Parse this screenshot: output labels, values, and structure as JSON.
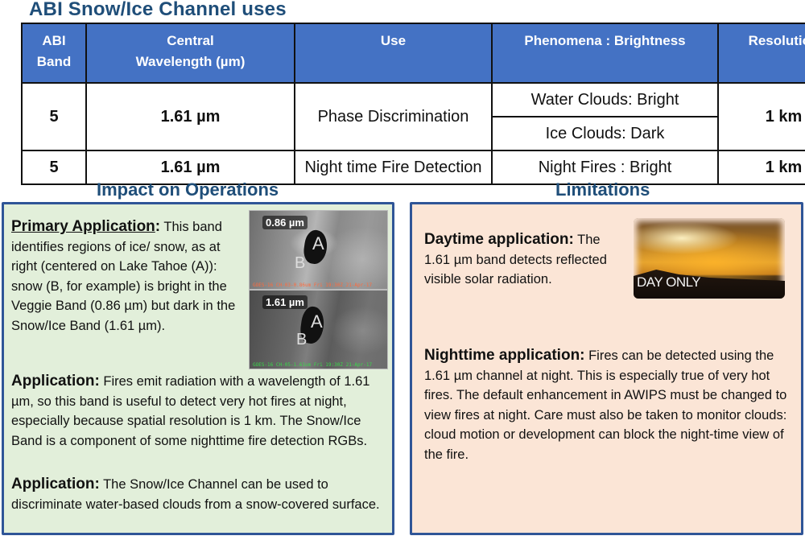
{
  "title": "ABI Snow/Ice Channel uses",
  "table": {
    "headers": [
      "ABI Band",
      "Central Wavelength (µm)",
      "Use",
      "Phenomena : Brightness",
      "Resolution"
    ],
    "header_lines": {
      "band_l1": "ABI",
      "band_l2": "Band",
      "wl_l1": "Central",
      "wl_l2": "Wavelength (µm)"
    },
    "rows": [
      {
        "band": "5",
        "wavelength": "1.61 µm",
        "use": "Phase Discrimination",
        "phenomena": [
          "Water Clouds: Bright",
          "Ice Clouds:  Dark"
        ],
        "resolution": "1 km"
      },
      {
        "band": "5",
        "wavelength": "1.61 µm",
        "use": "Night time Fire Detection",
        "phenomena": [
          "Night Fires : Bright"
        ],
        "resolution": "1 km"
      }
    ]
  },
  "impact": {
    "heading": "Impact on Operations",
    "primary_label": "Primary Application",
    "primary_colon": ":",
    "primary_text": " This band identifies regions of ice/ snow, as at right (centered on Lake Tahoe (A)): snow (B, for example) is bright in the Veggie Band (0.86 µm) but dark in the Snow/Ice Band (1.61 µm).",
    "app1_label": "Application:",
    "app1_text": " Fires emit radiation with a wavelength of 1.61 µm, so this band is useful to detect very hot fires at night, especially because spatial resolution is 1 km.  The Snow/Ice Band is a component of some nighttime fire detection RGBs.",
    "app2_label": "Application:",
    "app2_text": " The Snow/Ice Channel can be used to discriminate water-based clouds from a snow-covered surface.",
    "images": [
      {
        "label": "0.86 µm",
        "a": "A",
        "b": "B",
        "footer": "GOES-16 CH-03-0.86um   Fri 19:30Z 21-Apr-17"
      },
      {
        "label": "1.61 µm",
        "a": "A",
        "b": "B",
        "footer": "GOES-16 CH-05-1.61um   Fri 19:30Z 21-Apr-17"
      }
    ]
  },
  "limitations": {
    "heading": "Limitations",
    "day_label": "Daytime application:",
    "day_text": " The 1.61 µm  band detects reflected visible solar radiation.",
    "day_image_text": "DAY ONLY",
    "night_label": "Nighttime application:",
    "night_text": "  Fires can be detected using the 1.61 µm channel at night.  This is especially true of very hot fires.  The default enhancement in AWIPS must be changed to view fires at night.  Care must also be taken to monitor clouds:  cloud motion or development can block the night-time view of the fire."
  },
  "colors": {
    "header_blue": "#4472c4",
    "title_blue": "#1f4e79",
    "panel_border": "#2f5597",
    "impact_bg": "#e2efda",
    "limitations_bg": "#fbe5d6"
  }
}
